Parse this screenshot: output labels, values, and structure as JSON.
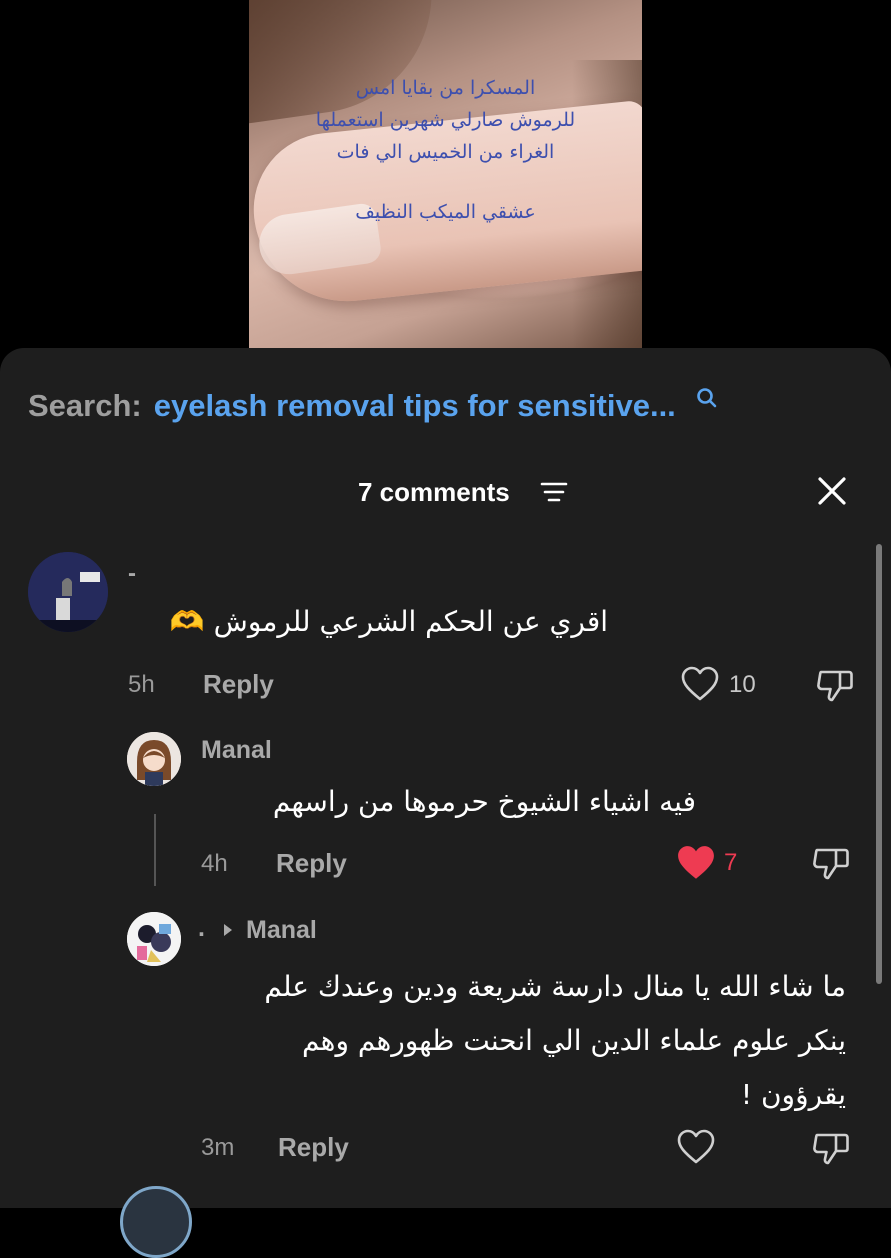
{
  "video": {
    "overlay_lines": [
      "المسكرا من بقايا امس",
      "للرموش صارلي شهرين استعملها",
      "الغراء من الخميس الي فات"
    ],
    "overlay_footer": "عشقي الميكب النظيف"
  },
  "search": {
    "prefix": "Search:",
    "query": "eyelash removal tips for sensitive..."
  },
  "comments_header": {
    "count_label": "7 comments"
  },
  "comments": [
    {
      "username": "-",
      "text": "اقري عن الحكم الشرعي للرموش 🫶",
      "time": "5h",
      "reply_label": "Reply",
      "likes": "10",
      "liked": false
    },
    {
      "username": "Manal",
      "text": "فيه اشياء الشيوخ حرموها من راسهم",
      "time": "4h",
      "reply_label": "Reply",
      "likes": "7",
      "liked": true
    },
    {
      "username": ".",
      "reply_to": "Manal",
      "text_lines": [
        "ما شاء الله يا منال دارسة شريعة ودين وعندك علم",
        "ينكر علوم علماء الدين الي انحنت ظهورهم وهم",
        "يقرؤون !"
      ],
      "time": "3m",
      "reply_label": "Reply",
      "likes": "",
      "liked": false
    }
  ],
  "colors": {
    "sheet_bg": "#1e1e1e",
    "search_query": "#5aa3ee",
    "liked_heart": "#ee3b52",
    "overlay_text": "#3d4fae"
  },
  "icons": [
    "search-icon",
    "filter-icon",
    "close-icon",
    "heart-icon",
    "dislike-icon",
    "reply-arrow-icon"
  ]
}
